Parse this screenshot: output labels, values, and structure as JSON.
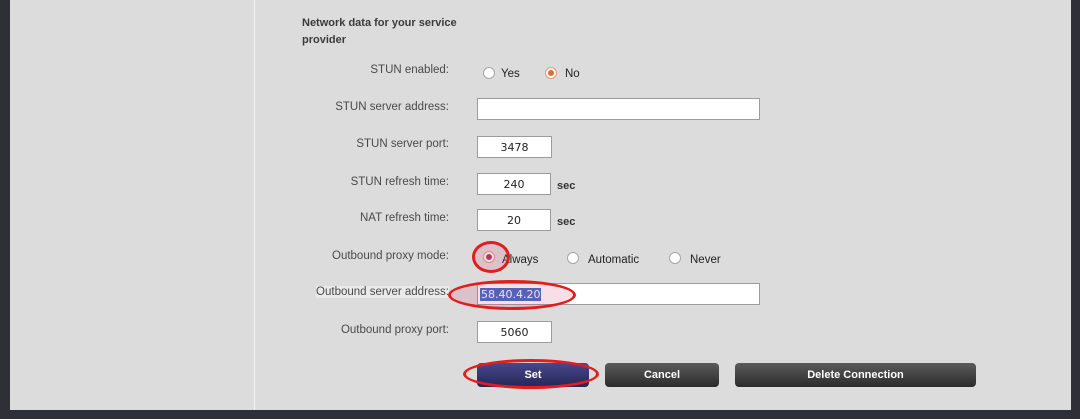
{
  "section": {
    "heading": "Network data for your service provider"
  },
  "fields": {
    "stun_enabled": {
      "label": "STUN enabled:",
      "options": [
        "Yes",
        "No"
      ],
      "selected": "No"
    },
    "stun_server_address": {
      "label": "STUN server address:",
      "value": ""
    },
    "stun_server_port": {
      "label": "STUN server port:",
      "value": "3478"
    },
    "stun_refresh_time": {
      "label": "STUN refresh time:",
      "value": "240",
      "unit": "sec"
    },
    "nat_refresh_time": {
      "label": "NAT refresh time:",
      "value": "20",
      "unit": "sec"
    },
    "outbound_proxy_mode": {
      "label": "Outbound proxy mode:",
      "options": [
        "Always",
        "Automatic",
        "Never"
      ],
      "selected": "Always"
    },
    "outbound_server_address": {
      "label": "Outbound server address:",
      "value": "58.40.4.20"
    },
    "outbound_proxy_port": {
      "label": "Outbound proxy port:",
      "value": "5060"
    }
  },
  "buttons": {
    "set": "Set",
    "cancel": "Cancel",
    "delete": "Delete Connection"
  },
  "colors": {
    "annotation": "#e21d1d",
    "radio_selected": "#e86a2a",
    "set_button": "#363678"
  }
}
